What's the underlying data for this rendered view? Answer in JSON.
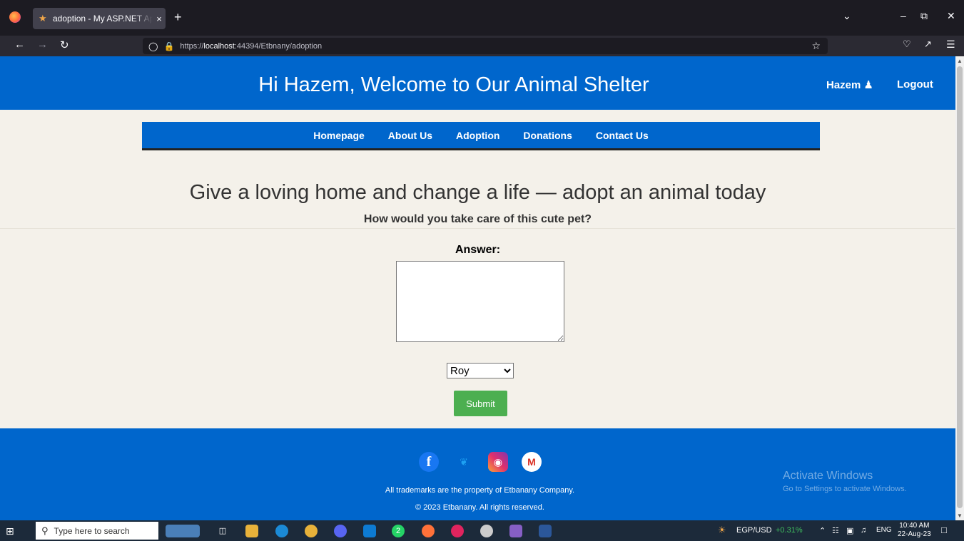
{
  "browser": {
    "tab_title": "adoption - My ASP.NET Application",
    "tab_close": "×",
    "new_tab": "+",
    "url_prefix": "https://",
    "url_host": "localhost",
    "url_rest": ":44394/Etbnany/adoption",
    "icons": [
      "firefox-icon",
      "back-icon",
      "forward-icon",
      "reload-icon",
      "shield-icon",
      "lock-icon",
      "star-icon",
      "pocket-icon",
      "share-icon",
      "menu-icon",
      "chevron-down-icon",
      "minimize-icon",
      "restore-icon",
      "close-icon"
    ]
  },
  "header": {
    "title": "Hi Hazem, Welcome to Our Animal Shelter",
    "user": "Hazem",
    "logout": "Logout"
  },
  "menu": {
    "items": [
      "Homepage",
      "About Us",
      "Adoption",
      "Donations",
      "Contact Us"
    ]
  },
  "main": {
    "lead": "Give a loving home and change a life — adopt an animal today",
    "question": "How would you take care of this cute pet?",
    "answer_label": "Answer:",
    "answer_value": "",
    "pet_selected": "Roy",
    "submit": "Submit"
  },
  "footer": {
    "social_icons": [
      "facebook-icon",
      "twitter-icon",
      "instagram-icon",
      "gmail-icon"
    ],
    "trademark": "All trademarks are the property of Etbanany Company.",
    "copyright": "© 2023 Etbanany. All rights reserved.",
    "activate_title": "Activate Windows",
    "activate_sub": "Go to Settings to activate Windows."
  },
  "taskbar": {
    "search_placeholder": "Type here to search",
    "ticker": "EGP/USD",
    "ticker_change": "+0.31%",
    "lang": "ENG",
    "time": "10:40 AM",
    "date": "22-Aug-23",
    "badge": "2"
  },
  "colors": {
    "brand": "#0066cc",
    "page_bg": "#f4f1ea",
    "submit": "#4caf50"
  }
}
